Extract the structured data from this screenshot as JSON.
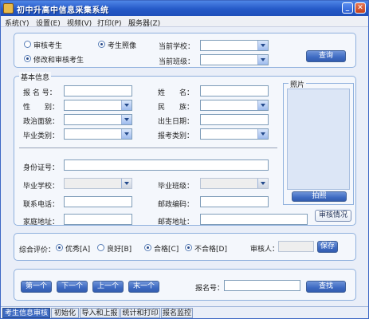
{
  "window": {
    "title": "初中升高中信息采集系统"
  },
  "menu": [
    "系统(Y)",
    "设置(E)",
    "视频(V)",
    "打印(P)",
    "服务器(Z)"
  ],
  "mode": {
    "options": [
      {
        "label": "审核考生",
        "selected": false
      },
      {
        "label": "考生照像",
        "selected": true
      },
      {
        "label": "修改和审核考生",
        "selected": true
      }
    ],
    "school_label": "当前学校：",
    "class_label": "当前班级：",
    "query_button": "查询"
  },
  "basic": {
    "legend": "基本信息",
    "fields": {
      "exam_no": "报 名 号：",
      "name": "姓　　名：",
      "gender": "性　　别：",
      "ethnicity": "民　　族：",
      "politics": "政治面貌：",
      "birthdate": "出生日期：",
      "grad_type": "毕业类别：",
      "exam_type": "报考类别：",
      "id_no": "身份证号：",
      "grad_school": "毕业学校：",
      "grad_class": "毕业班级：",
      "phone": "联系电话：",
      "postcode": "邮政编码：",
      "home_addr": "家庭地址：",
      "mail_addr": "邮寄地址："
    },
    "photo_title": "照片",
    "shoot_button": "拍照",
    "review_button": "审核情况"
  },
  "evaluation": {
    "label": "综合评价：",
    "options": [
      {
        "label": "优秀[A]",
        "selected": true
      },
      {
        "label": "良好[B]",
        "selected": false
      },
      {
        "label": "合格[C]",
        "selected": true
      },
      {
        "label": "不合格[D]",
        "selected": false
      }
    ],
    "reviewer_label": "审核人：",
    "save_button": "保存"
  },
  "navigation": {
    "first": "第一个",
    "next": "下一个",
    "prev": "上一个",
    "last": "末一个",
    "search_label": "报名号：",
    "search_button": "查找"
  },
  "tabs": [
    {
      "label": "考生信息审核",
      "active": true
    },
    {
      "label": "初始化",
      "active": false
    },
    {
      "label": "导入和上报",
      "active": false
    },
    {
      "label": "统计和打印",
      "active": false
    },
    {
      "label": "报名监控",
      "active": false
    }
  ]
}
